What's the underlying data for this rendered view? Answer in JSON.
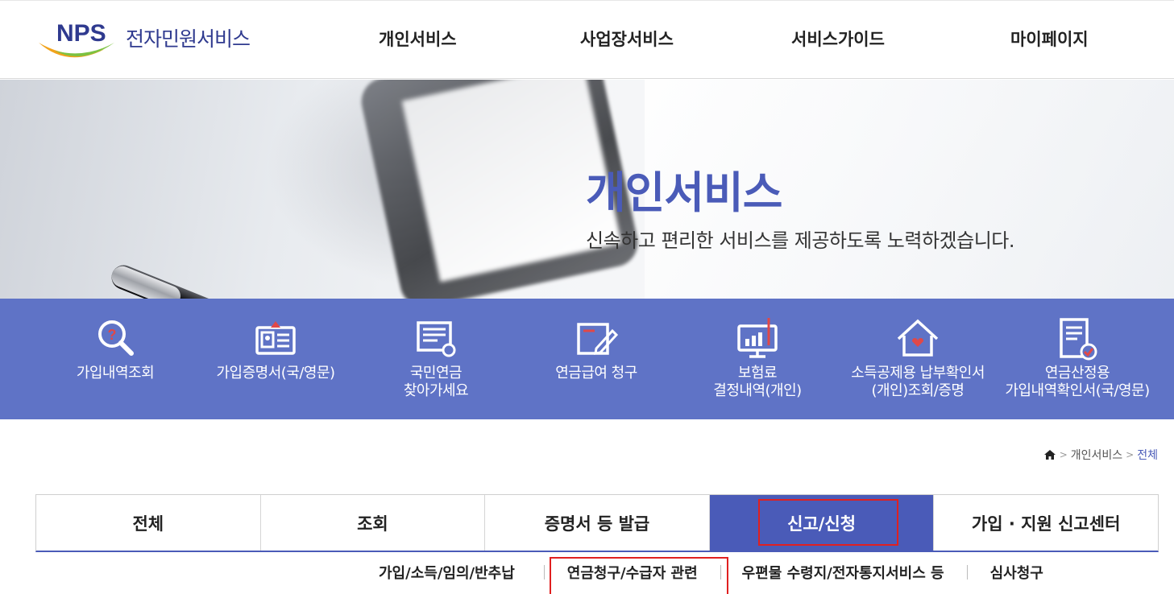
{
  "header": {
    "logo_mark": "NPS",
    "logo_text": "전자민원서비스",
    "nav": [
      "개인서비스",
      "사업장서비스",
      "서비스가이드",
      "마이페이지"
    ]
  },
  "hero": {
    "title": "개인서비스",
    "subtitle": "신속하고 편리한 서비스를 제공하도록 노력하겠습니다."
  },
  "quick_menu": [
    {
      "label": "가입내역조회",
      "icon": "search-question-icon"
    },
    {
      "label": "가입증명서(국/영문)",
      "icon": "id-card-icon"
    },
    {
      "label": "국민연금\n찾아가세요",
      "icon": "document-search-icon"
    },
    {
      "label": "연금급여 청구",
      "icon": "edit-document-icon"
    },
    {
      "label": "보험료\n결정내역(개인)",
      "icon": "monitor-chart-icon"
    },
    {
      "label": "소득공제용 납부확인서\n(개인)조회/증명",
      "icon": "house-heart-icon"
    },
    {
      "label": "연금산정용\n가입내역확인서(국/영문)",
      "icon": "document-check-icon"
    }
  ],
  "breadcrumb": {
    "home_icon": "home-icon",
    "items": [
      "개인서비스",
      "전체"
    ]
  },
  "tabs": [
    "전체",
    "조회",
    "증명서 등 발급",
    "신고/신청",
    "가입 · 지원 신고센터"
  ],
  "active_tab": "신고/신청",
  "subtabs": [
    "가입/소득/임의/반추납",
    "연금청구/수급자 관련",
    "우편물 수령지/전자통지서비스 등",
    "심사청구"
  ],
  "colors": {
    "primary": "#5f73c6",
    "brand_blue": "#4a5bb8",
    "highlight_red": "#e02020"
  }
}
